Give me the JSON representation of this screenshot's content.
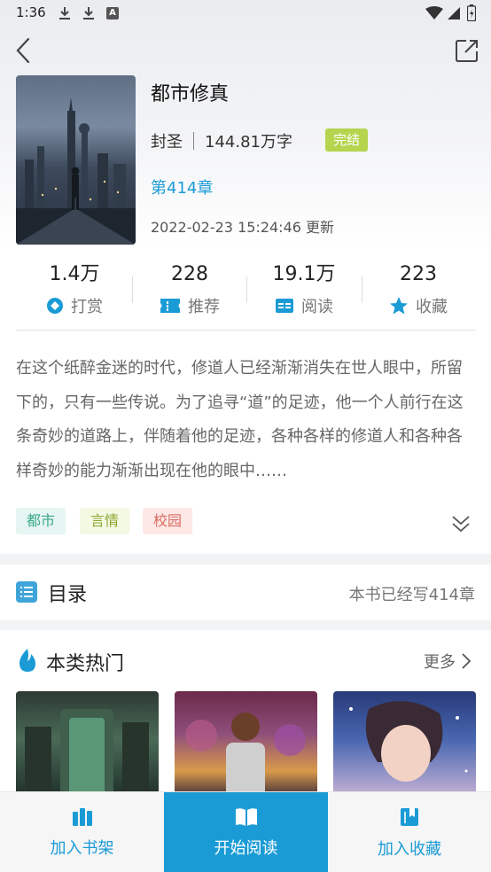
{
  "status_bar": {
    "time": "1:36",
    "badge": "A"
  },
  "book": {
    "title": "都市修真",
    "author": "封圣",
    "word_count": "144.81万字",
    "status": "完结",
    "latest_chapter": "第414章",
    "update_time": "2022-02-23 15:24:46 更新"
  },
  "stats": [
    {
      "value": "1.4万",
      "label": "打赏",
      "icon": "reward-icon"
    },
    {
      "value": "228",
      "label": "推荐",
      "icon": "ticket-icon"
    },
    {
      "value": "19.1万",
      "label": "阅读",
      "icon": "read-icon"
    },
    {
      "value": "223",
      "label": "收藏",
      "icon": "star-icon"
    }
  ],
  "synopsis": "在这个纸醉金迷的时代，修道人已经渐渐消失在世人眼中，所留下的，只有一些传说。为了追寻“道”的足迹，他一个人前行在这条奇妙的道路上，伴随着他的足迹，各种各样的修道人和各种各样奇妙的能力渐渐出现在他的眼中……",
  "tags": [
    "都市",
    "言情",
    "校园"
  ],
  "toc": {
    "title": "目录",
    "count_text": "本书已经写414章"
  },
  "hot": {
    "title": "本类热门",
    "more": "更多"
  },
  "bottom_bar": {
    "shelf": "加入书架",
    "read": "开始阅读",
    "collect": "加入收藏"
  },
  "colors": {
    "accent": "#1b9bd6",
    "status_tag": "#b5d54f"
  }
}
